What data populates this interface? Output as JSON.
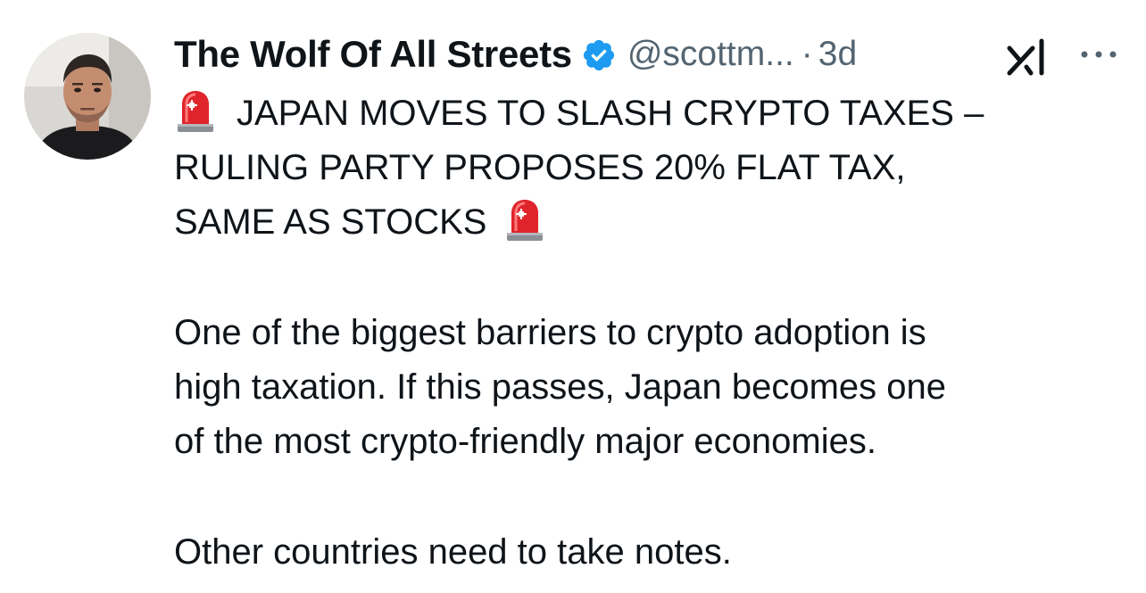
{
  "author": {
    "display_name": "The Wolf Of All Streets",
    "handle": "@scottm...",
    "separator": "·",
    "timestamp": "3d",
    "verified_icon": "verified-badge-icon",
    "verified_color": "#1d9bf0"
  },
  "toolbar": {
    "grok_icon": "grok-icon",
    "more_icon": "more-options-icon"
  },
  "tweet": {
    "headline_lines": [
      "JAPAN MOVES TO SLASH CRYPTO TAXES –",
      "RULING PARTY PROPOSES 20% FLAT TAX,",
      "SAME AS STOCKS"
    ],
    "paragraph_lines": [
      "One of the biggest barriers to crypto adoption is",
      "high taxation. If this passes, Japan becomes one",
      "of the most crypto-friendly major economies."
    ],
    "closing": "Other countries need to take notes.",
    "emoji_icon": "police-siren-icon"
  },
  "colors": {
    "text_primary": "#0f1419",
    "text_secondary": "#536471",
    "siren_red": "#e0242b"
  }
}
